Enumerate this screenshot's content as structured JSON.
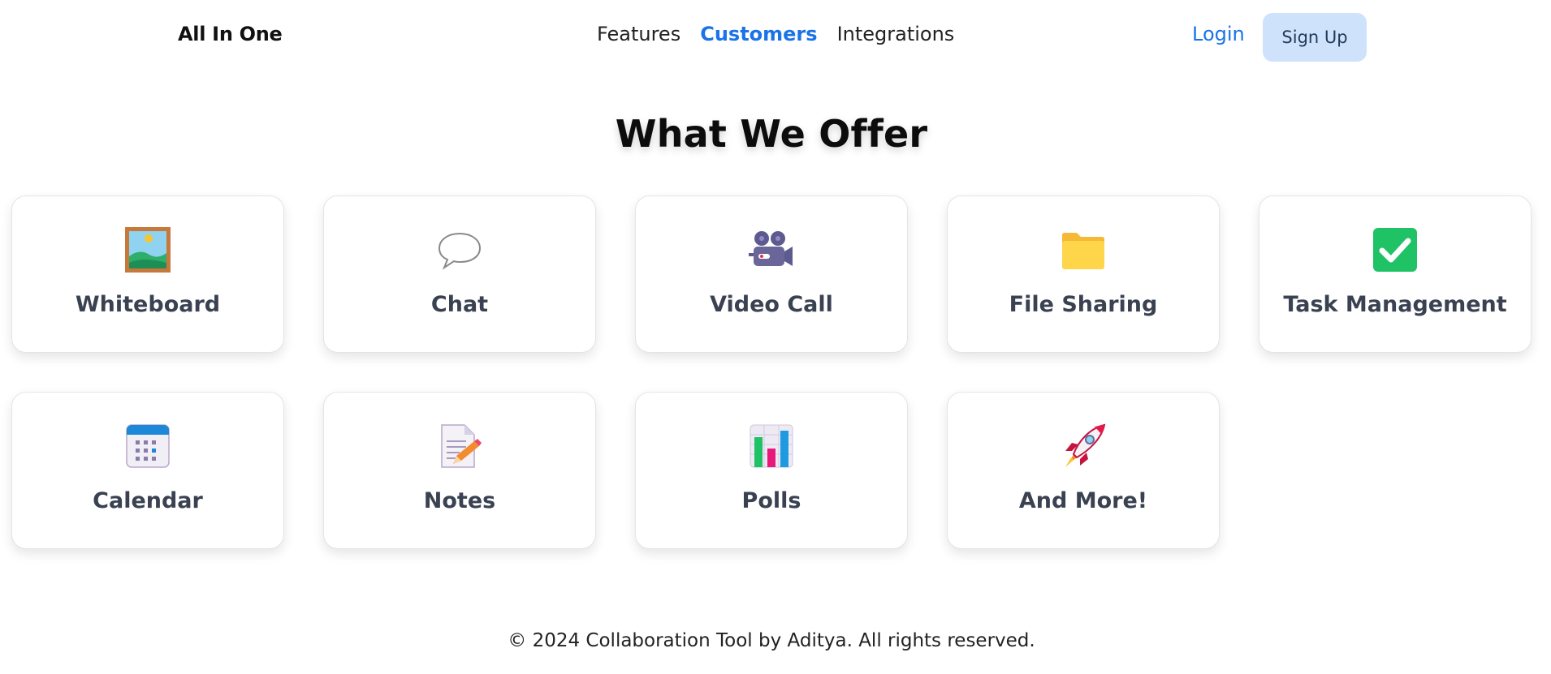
{
  "header": {
    "brand": "All In One",
    "nav": [
      {
        "label": "Features",
        "active": false
      },
      {
        "label": "Customers",
        "active": true
      },
      {
        "label": "Integrations",
        "active": false
      }
    ],
    "login_label": "Login",
    "signup_label": "Sign Up"
  },
  "main": {
    "heading": "What We Offer",
    "cards": [
      {
        "label": "Whiteboard",
        "icon": "framed-picture-icon"
      },
      {
        "label": "Chat",
        "icon": "speech-bubble-icon"
      },
      {
        "label": "Video Call",
        "icon": "movie-camera-icon"
      },
      {
        "label": "File Sharing",
        "icon": "folder-icon"
      },
      {
        "label": "Task Management",
        "icon": "checkmark-icon"
      },
      {
        "label": "Calendar",
        "icon": "calendar-icon"
      },
      {
        "label": "Notes",
        "icon": "notepad-pencil-icon"
      },
      {
        "label": "Polls",
        "icon": "bar-chart-icon"
      },
      {
        "label": "And More!",
        "icon": "rocket-icon"
      }
    ]
  },
  "footer": {
    "text": "© 2024 Collaboration Tool by Aditya. All rights reserved."
  },
  "colors": {
    "accent": "#1a73e8",
    "signup_bg": "#cfe2fb",
    "card_label": "#3a4252"
  }
}
